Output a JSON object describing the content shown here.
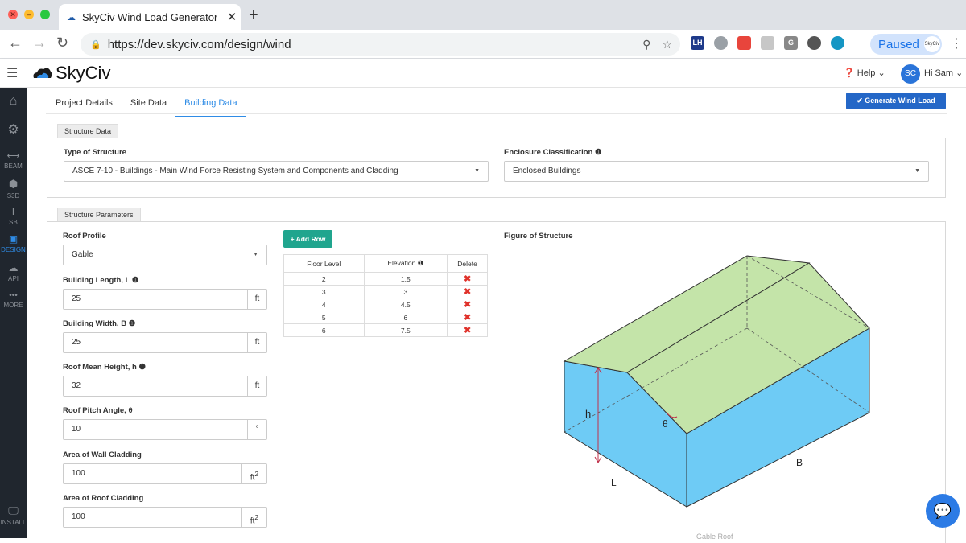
{
  "browser": {
    "tab_title": "SkyCiv Wind Load Generator |",
    "url": "https://dev.skyciv.com/design/wind",
    "paused_label": "Paused",
    "profile_badge": "SkyCiv",
    "ext_lh": "LH",
    "ext_g": "G"
  },
  "app": {
    "brand": "SkyCiv",
    "help_label": "Help",
    "user_initials": "SC",
    "user_greeting": "Hi Sam"
  },
  "sidebar": {
    "items": [
      {
        "label": ""
      },
      {
        "label": ""
      },
      {
        "label": "BEAM"
      },
      {
        "label": "S3D"
      },
      {
        "label": "SB"
      },
      {
        "label": "DESIGN"
      },
      {
        "label": "API"
      },
      {
        "label": "MORE"
      },
      {
        "label": "INSTALL"
      }
    ]
  },
  "tabs": [
    {
      "label": "Project Details"
    },
    {
      "label": "Site Data"
    },
    {
      "label": "Building Data"
    }
  ],
  "generate_button": "Generate Wind Load",
  "structure_data": {
    "section_title": "Structure Data",
    "type_label": "Type of Structure",
    "type_value": "ASCE 7-10 - Buildings - Main Wind Force Resisting System and Components and Cladding",
    "enclosure_label": "Enclosure Classification",
    "enclosure_value": "Enclosed Buildings"
  },
  "structure_params": {
    "section_title": "Structure Parameters",
    "roof_profile_label": "Roof Profile",
    "roof_profile_value": "Gable",
    "length_label": "Building Length, L",
    "length_value": "25",
    "length_unit": "ft",
    "width_label": "Building Width, B",
    "width_value": "25",
    "width_unit": "ft",
    "height_label": "Roof Mean Height, h",
    "height_value": "32",
    "height_unit": "ft",
    "pitch_label": "Roof Pitch Angle, θ",
    "pitch_value": "10",
    "pitch_unit": "°",
    "wall_label": "Area of Wall Cladding",
    "wall_value": "100",
    "wall_unit": "ft",
    "roof_clad_label": "Area of Roof Cladding",
    "roof_clad_value": "100",
    "roof_clad_unit": "ft",
    "unit_exp": "2"
  },
  "floors": {
    "add_row": "Add Row",
    "headers": [
      "Floor Level",
      "Elevation",
      "Delete"
    ],
    "rows": [
      {
        "level": "2",
        "elevation": "1.5"
      },
      {
        "level": "3",
        "elevation": "3"
      },
      {
        "level": "4",
        "elevation": "4.5"
      },
      {
        "level": "5",
        "elevation": "6"
      },
      {
        "level": "6",
        "elevation": "7.5"
      }
    ]
  },
  "figure": {
    "title": "Figure of Structure",
    "label_h": "h",
    "label_theta": "θ",
    "label_B": "B",
    "label_L": "L",
    "bottom_text": "Gable Roof",
    "wall_color": "#6ecbf5",
    "roof_color": "#c4e4a9"
  }
}
